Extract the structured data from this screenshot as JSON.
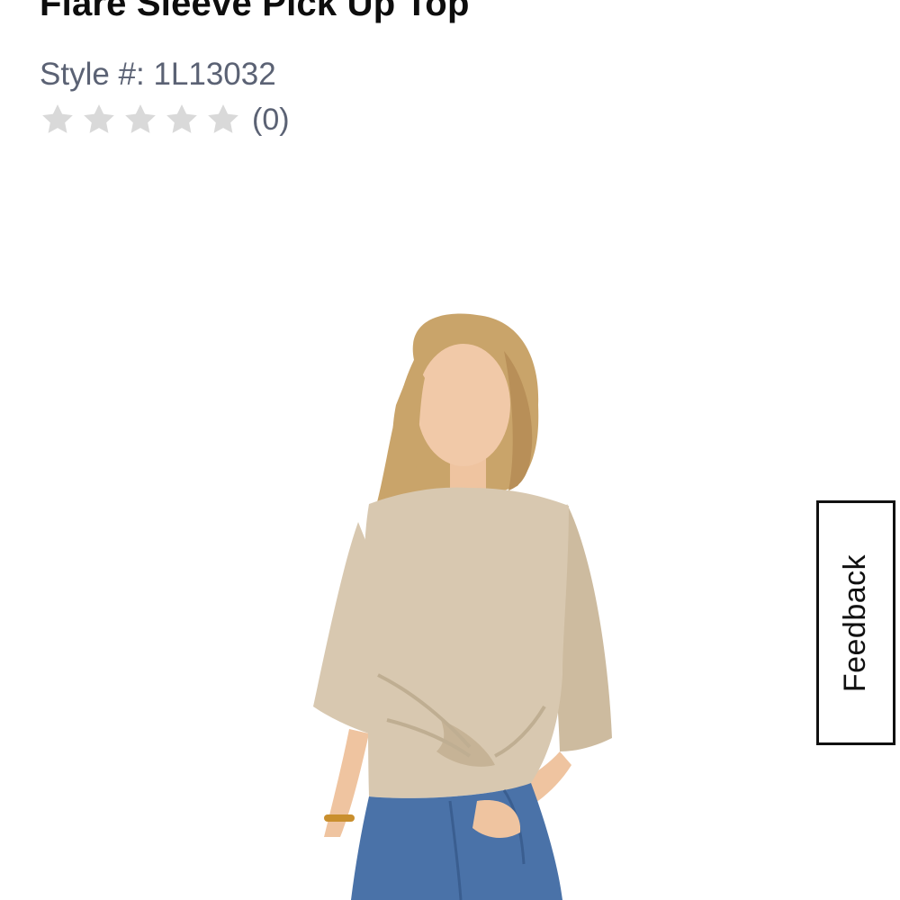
{
  "product": {
    "title": "Flare Sleeve Pick Up Top",
    "style_prefix": "Style #: 1L13032",
    "rating": {
      "stars_filled": 0,
      "stars_total": 5,
      "review_count_label": "(0)"
    },
    "image": {
      "alt": "Model wearing beige flare sleeve pick up top with jeans",
      "top_color": "#d8c8b0",
      "jeans_color": "#4a72a8",
      "hair_color": "#c9a46a",
      "skin_color": "#f1c9a8"
    }
  },
  "feedback": {
    "label": "Feedback"
  },
  "colors": {
    "title": "#0d0d0d",
    "meta": "#5b6274",
    "star_empty": "#d9d9d9"
  }
}
